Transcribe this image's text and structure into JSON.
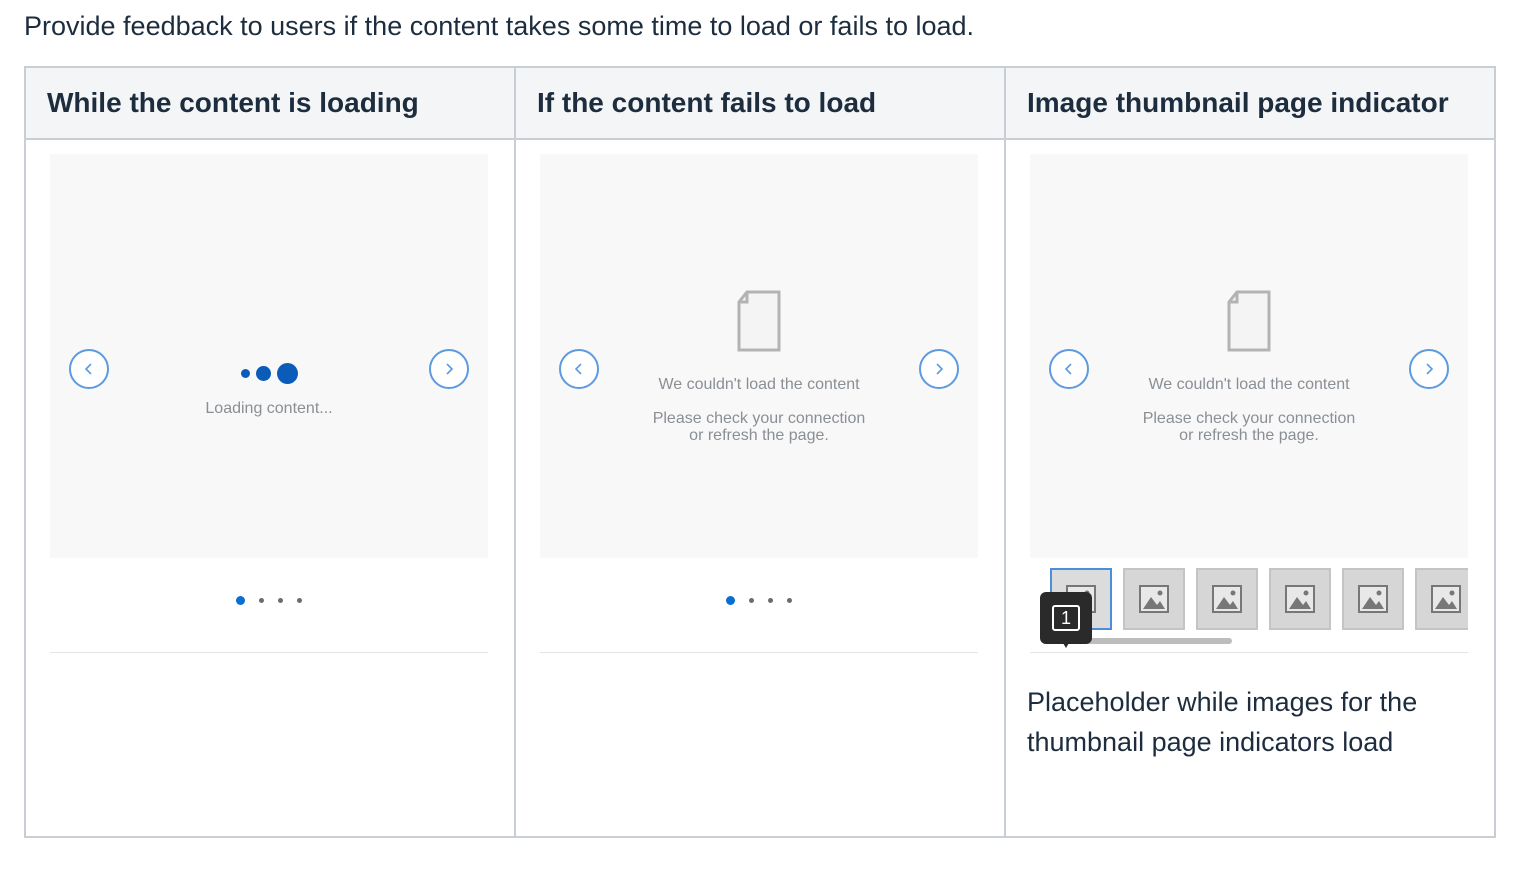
{
  "intro": "Provide feedback to users if the content takes some time to load or fails to load.",
  "table": {
    "headers": [
      "While the content is loading",
      "If the content fails to load",
      "Image thumbnail page indicator"
    ]
  },
  "loading_example": {
    "message": "Loading content...",
    "pager": {
      "pages": 4,
      "active_page": 1
    }
  },
  "failed_example": {
    "title": "We couldn't load the content",
    "hint_line1": "Please check your connection",
    "hint_line2": "or refresh the page.",
    "pager": {
      "pages": 4,
      "active_page": 1
    }
  },
  "thumbnail_example": {
    "title": "We couldn't load the content",
    "hint_line1": "Please check your connection",
    "hint_line2": "or refresh the page.",
    "badge_number": "1",
    "visible_thumbnails": 6,
    "selected_thumbnail": 1,
    "caption": "Placeholder while images for the thumbnail page indicators load"
  },
  "icons": {
    "previous": "chevron-left-icon",
    "next": "chevron-right-icon",
    "document": "document-icon",
    "image_placeholder": "image-placeholder-icon"
  },
  "colors": {
    "accent": "#0a6ed1",
    "loading_dots": "#0b5cb8",
    "nav_border": "#5d9ae0",
    "header_bg": "#f3f5f7",
    "stage_bg": "#f8f8f9"
  }
}
